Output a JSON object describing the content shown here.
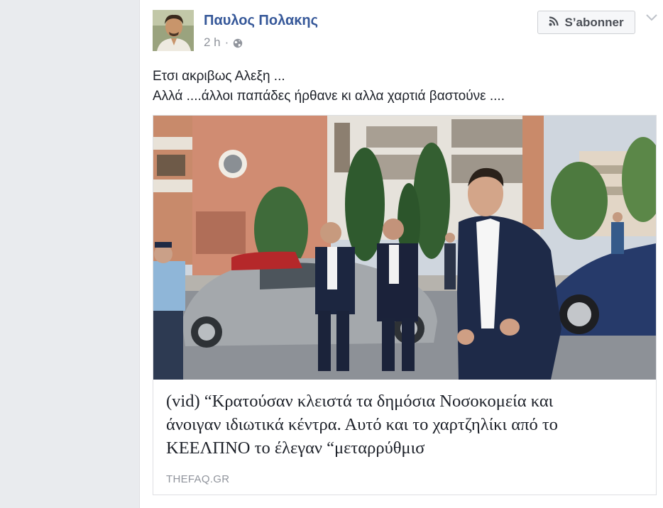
{
  "post": {
    "author": "Παυλος Πολακης",
    "time": "2 h",
    "separator": "·",
    "follow_label": "S’abonner",
    "text_lines": [
      "Ετσι ακριβως Αλεξη ...",
      "Αλλά ....άλλοι παπάδες ήρθανε κι αλλα χαρτιά βαστούνε ...."
    ]
  },
  "link": {
    "title_lines": [
      "(vid) “Κρατούσαν κλειστά τα δημόσια Νοσοκομεία και",
      "άνοιγαν ιδιωτικά κέντρα. Αυτό και το χαρτζηλίκι από το",
      "ΚΕΕΛΠΝΟ το έλεγαν “μεταρρύθμισ"
    ],
    "source": "THEFAQ.GR"
  },
  "icons": {
    "privacy": "globe-icon",
    "follow": "rss-icon",
    "menu": "chevron-down-icon"
  },
  "colors": {
    "author": "#365899",
    "meta": "#90949c",
    "text": "#1d2129",
    "page_bg": "#e9ebee"
  }
}
